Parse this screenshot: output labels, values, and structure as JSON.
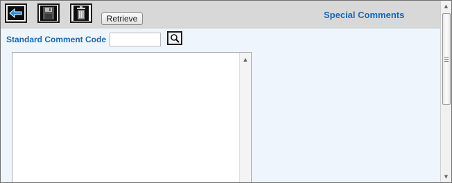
{
  "header": {
    "title": "Special Comments",
    "retrieve_label": "Retrieve"
  },
  "toolbar": {
    "buttons": [
      {
        "icon": "back-arrow-icon"
      },
      {
        "icon": "save-disk-icon"
      },
      {
        "icon": "delete-trash-icon"
      }
    ]
  },
  "form": {
    "code_label": "Standard Comment Code",
    "code_value": "",
    "lookup_icon": "magnifier-icon",
    "comment_text": ""
  },
  "colors": {
    "accent": "#1e67a8",
    "background": "#eef5fc",
    "toolbar": "#d8d8d8",
    "back_arrow": "#1f8fe0"
  }
}
